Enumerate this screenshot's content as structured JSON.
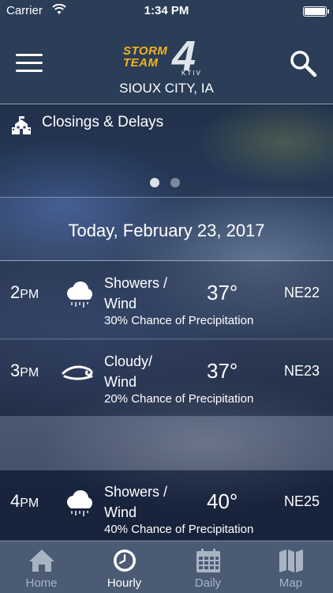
{
  "status_bar": {
    "carrier": "Carrier",
    "time": "1:34 PM"
  },
  "header": {
    "logo": {
      "line1": "STORM",
      "line2": "TEAM",
      "number": "4",
      "station": "KTIV"
    },
    "location": "SIOUX CITY, IA",
    "menu_icon": "hamburger-icon",
    "search_icon": "search-icon"
  },
  "banner": {
    "icon": "school-icon",
    "label": "Closings & Delays",
    "pages": 2,
    "active_page": 1
  },
  "forecast": {
    "date": "Today, February 23, 2017",
    "rows": [
      {
        "hour": "2",
        "ampm": "PM",
        "icon": "showers-icon",
        "condition_line1": "Showers /",
        "condition_line2": "Wind",
        "precip": "30% Chance of Precipitation",
        "temp": "37°",
        "wind": "NE22"
      },
      {
        "hour": "3",
        "ampm": "PM",
        "icon": "wind-icon",
        "condition_line1": "Cloudy/",
        "condition_line2": "Wind",
        "precip": "20% Chance of Precipitation",
        "temp": "37°",
        "wind": "NE23"
      },
      {
        "hour": "4",
        "ampm": "PM",
        "icon": "showers-icon",
        "condition_line1": "Showers /",
        "condition_line2": "Wind",
        "precip": "40% Chance of Precipitation",
        "temp": "40°",
        "wind": "NE25"
      }
    ]
  },
  "tabs": [
    {
      "label": "Home",
      "icon": "home-icon",
      "active": false
    },
    {
      "label": "Hourly",
      "icon": "clock-icon",
      "active": true
    },
    {
      "label": "Daily",
      "icon": "calendar-icon",
      "active": false
    },
    {
      "label": "Map",
      "icon": "map-icon",
      "active": false
    }
  ],
  "colors": {
    "header_bg": "#2b3d57",
    "tabbar_bg": "#4a5b73",
    "logo_accent": "#f2b51c",
    "tab_inactive": "#a9b4c3",
    "tab_active": "#ffffff"
  }
}
